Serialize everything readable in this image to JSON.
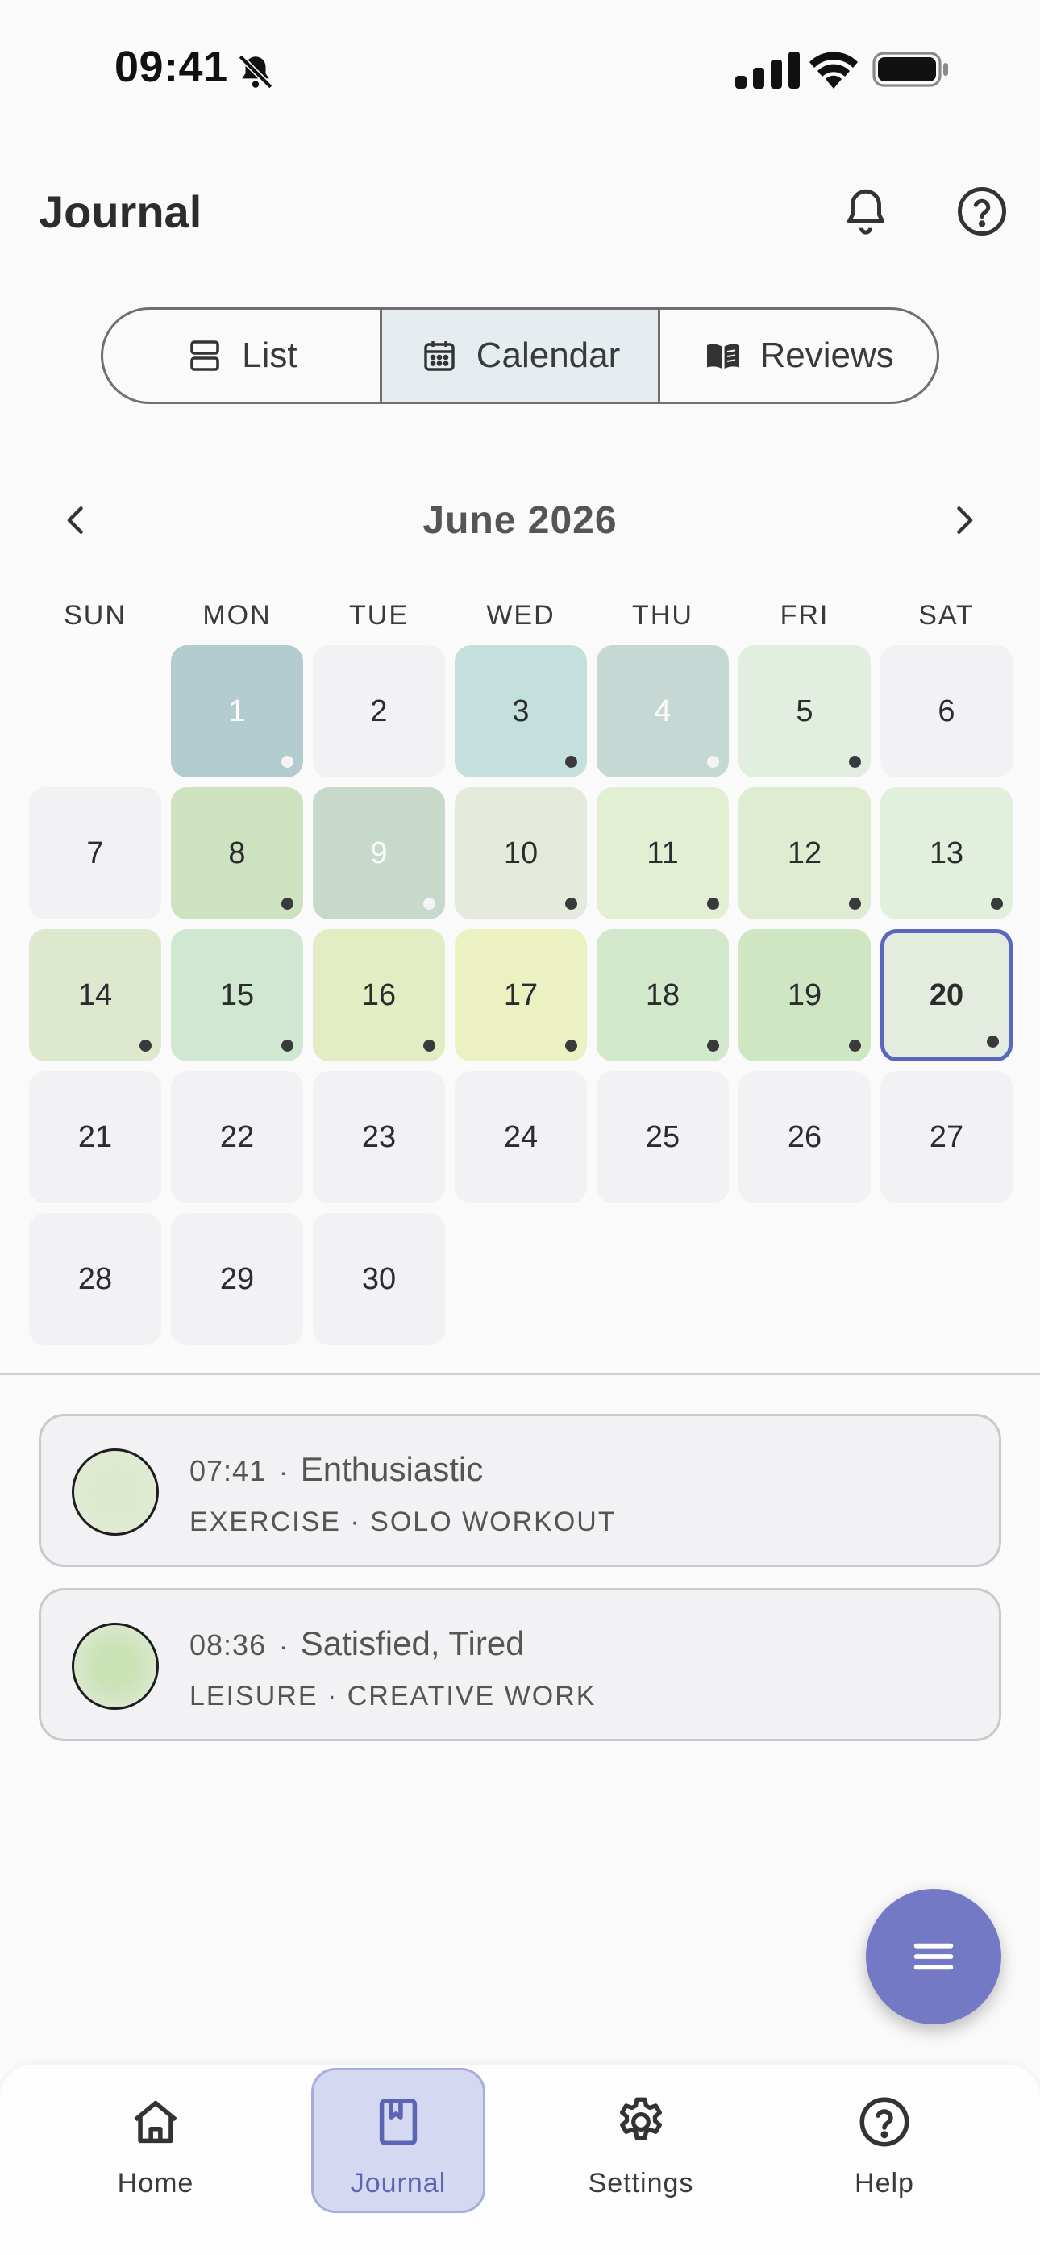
{
  "status_bar": {
    "time": "09:41"
  },
  "header": {
    "title": "Journal"
  },
  "view_switcher": {
    "options": [
      {
        "label": "List",
        "icon": "list-view-icon",
        "selected": false
      },
      {
        "label": "Calendar",
        "icon": "calendar-icon",
        "selected": true
      },
      {
        "label": "Reviews",
        "icon": "book-open-icon",
        "selected": false
      }
    ]
  },
  "calendar": {
    "month_label": "June 2026",
    "weekdays": [
      "SUN",
      "MON",
      "TUE",
      "WED",
      "THU",
      "FRI",
      "SAT"
    ],
    "days": [
      {
        "day": "1",
        "color": "#b2ccd0",
        "entry": true,
        "light": true
      },
      {
        "day": "2",
        "color": "#f2f2f4",
        "entry": false
      },
      {
        "day": "3",
        "color": "#c4e0dc",
        "entry": true
      },
      {
        "day": "4",
        "color": "#c6d8d3",
        "entry": true,
        "light": true
      },
      {
        "day": "5",
        "color": "#e2eedf",
        "entry": true
      },
      {
        "day": "6",
        "color": "#f2f2f4",
        "entry": false
      },
      {
        "day": "7",
        "color": "#f2f2f4",
        "entry": false
      },
      {
        "day": "8",
        "color": "#cde3bf",
        "entry": true
      },
      {
        "day": "9",
        "color": "#c6d9cb",
        "entry": true,
        "light": true
      },
      {
        "day": "10",
        "color": "#e4ebdc",
        "entry": true
      },
      {
        "day": "11",
        "color": "#e2efd2",
        "entry": true
      },
      {
        "day": "12",
        "color": "#e0ecd1",
        "entry": true
      },
      {
        "day": "13",
        "color": "#e3efdd",
        "entry": true
      },
      {
        "day": "14",
        "color": "#dde8cc",
        "entry": true
      },
      {
        "day": "15",
        "color": "#d0e8d1",
        "entry": true
      },
      {
        "day": "16",
        "color": "#e3edc3",
        "entry": true
      },
      {
        "day": "17",
        "color": "#ebf1c0",
        "entry": true
      },
      {
        "day": "18",
        "color": "#d1e8cb",
        "entry": true
      },
      {
        "day": "19",
        "color": "#cfe6c3",
        "entry": true
      },
      {
        "day": "20",
        "color": "#e3ecde",
        "entry": true,
        "today": true
      },
      {
        "day": "21",
        "color": "#f2f2f4",
        "entry": false
      },
      {
        "day": "22",
        "color": "#f2f2f4",
        "entry": false
      },
      {
        "day": "23",
        "color": "#f2f2f4",
        "entry": false
      },
      {
        "day": "24",
        "color": "#f2f2f4",
        "entry": false
      },
      {
        "day": "25",
        "color": "#f2f2f4",
        "entry": false
      },
      {
        "day": "26",
        "color": "#f2f2f4",
        "entry": false
      },
      {
        "day": "27",
        "color": "#f2f2f4",
        "entry": false
      },
      {
        "day": "28",
        "color": "#f2f2f4",
        "entry": false
      },
      {
        "day": "29",
        "color": "#f2f2f4",
        "entry": false
      },
      {
        "day": "30",
        "color": "#f2f2f4",
        "entry": false
      }
    ]
  },
  "entries": [
    {
      "time": "07:41",
      "separator": "·",
      "mood": "Enthusiastic",
      "category": "EXERCISE · SOLO WORKOUT",
      "color": "#dce9cc"
    },
    {
      "time": "08:36",
      "separator": "·",
      "mood": "Satisfied, Tired",
      "category": "LEISURE · CREATIVE WORK",
      "color": "#c9e2b6"
    }
  ],
  "fab": {
    "icon": "menu-icon"
  },
  "bottom_nav": [
    {
      "label": "Home",
      "icon": "home-icon",
      "active": false
    },
    {
      "label": "Journal",
      "icon": "journal-icon",
      "active": true
    },
    {
      "label": "Settings",
      "icon": "gear-icon",
      "active": false
    },
    {
      "label": "Help",
      "icon": "help-icon",
      "active": false
    }
  ],
  "colors": {
    "accent": "#7479c5",
    "today_border": "#5a66c0",
    "nav_active_bg": "#d5d8f1"
  }
}
